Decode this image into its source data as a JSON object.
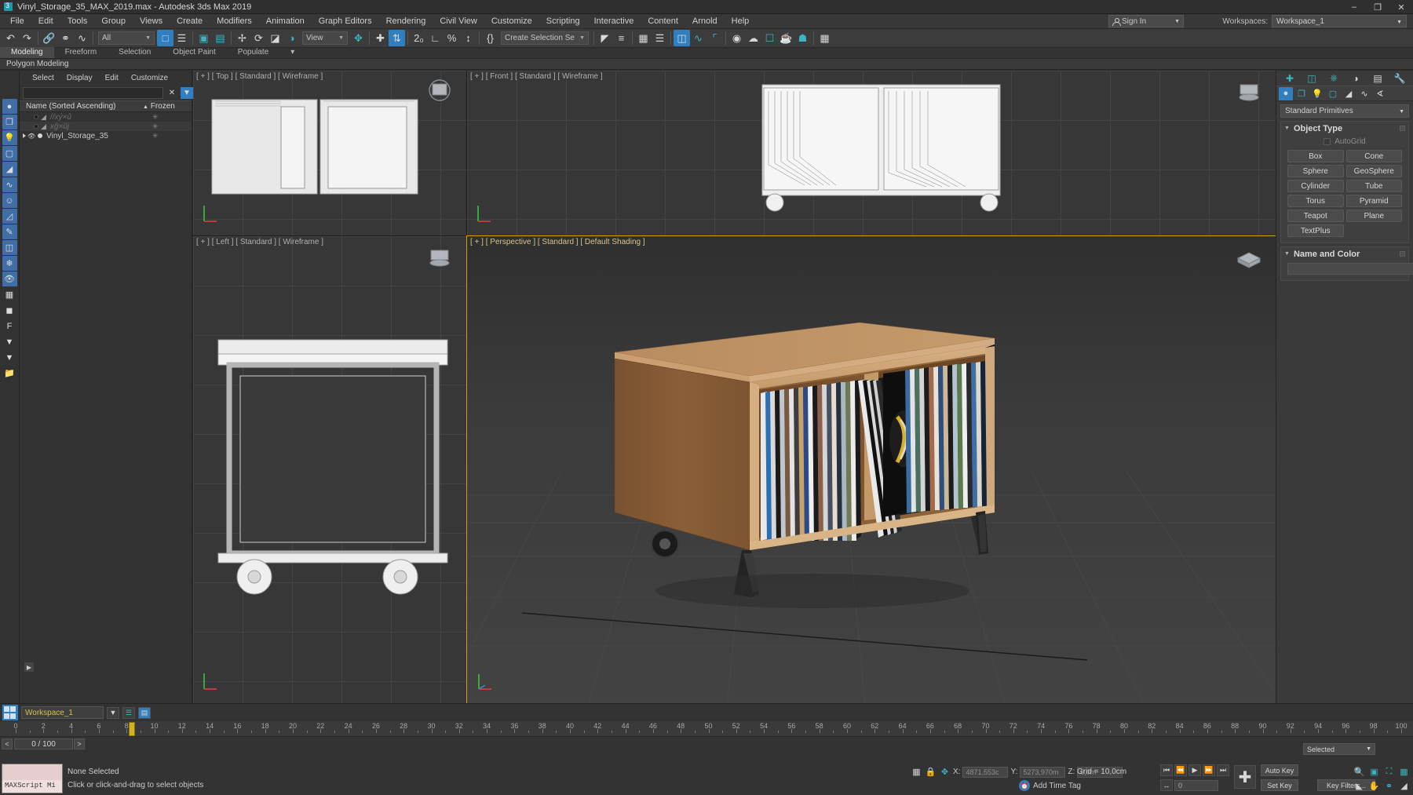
{
  "titlebar": {
    "title": "Vinyl_Storage_35_MAX_2019.max - Autodesk 3ds Max 2019",
    "minimize": "–",
    "maximize": "❐",
    "close": "✕"
  },
  "menubar": {
    "items": [
      "File",
      "Edit",
      "Tools",
      "Group",
      "Views",
      "Create",
      "Modifiers",
      "Animation",
      "Graph Editors",
      "Rendering",
      "Civil View",
      "Customize",
      "Scripting",
      "Interactive",
      "Content",
      "Arnold",
      "Help"
    ],
    "signin": "Sign In",
    "workspaces_label": "Workspaces:",
    "workspace_value": "Workspace_1"
  },
  "toolbar": {
    "selection_filter": "All",
    "selection_set": "Create Selection Se",
    "ref_coord": "View",
    "icons": [
      "undo",
      "redo",
      "select-link",
      "unlink",
      "bind-space-warp",
      "select-object",
      "select-by-name",
      "rectangular-select",
      "window-crossing",
      "select-and-move",
      "select-and-rotate",
      "select-and-scale",
      "place-tool",
      "snaps-toggle",
      "angle-snap",
      "percent-snap",
      "spinner-snap",
      "named-selection-sets",
      "mirror",
      "align",
      "layer-explorer",
      "scene-explorer",
      "ribbon-toggle",
      "curve-editor",
      "schematic-view",
      "material-editor",
      "render-setup",
      "render-frame",
      "render-production"
    ]
  },
  "ribbon": {
    "tabs": [
      "Modeling",
      "Freeform",
      "Selection",
      "Object Paint",
      "Populate"
    ],
    "active_tab": "Modeling",
    "subtitle": "Polygon Modeling"
  },
  "explorer": {
    "menu": [
      "Select",
      "Display",
      "Edit",
      "Customize"
    ],
    "search_placeholder": "",
    "col_name": "Name (Sorted Ascending)",
    "col_frozen": "Frozen",
    "rows": [
      {
        "name": "//xý×û",
        "frozen": "✳",
        "dim": true
      },
      {
        "name": "xĝ×ŭj",
        "frozen": "✳",
        "dim": true
      },
      {
        "name": "Vinyl_Storage_35",
        "frozen": "✳",
        "dim": false
      }
    ]
  },
  "viewports": [
    {
      "id": "top",
      "label": "[ + ] [ Top ] [ Standard ] [ Wireframe ]",
      "active": false
    },
    {
      "id": "front",
      "label": "[ + ] [ Front ] [ Standard ] [ Wireframe ]",
      "active": false
    },
    {
      "id": "left",
      "label": "[ + ] [ Left ] [ Standard ] [ Wireframe ]",
      "active": false
    },
    {
      "id": "perspective",
      "label": "[ + ] [ Perspective ] [ Standard ] [ Default Shading ]",
      "active": true
    }
  ],
  "command_panel": {
    "tabs": [
      "create-tab",
      "modify-tab",
      "hierarchy-tab",
      "motion-tab",
      "display-tab",
      "utilities-tab"
    ],
    "category": "Standard Primitives",
    "object_type": {
      "title": "Object Type",
      "autogrid": "AutoGrid",
      "buttons": [
        "Box",
        "Cone",
        "Sphere",
        "GeoSphere",
        "Cylinder",
        "Tube",
        "Torus",
        "Pyramid",
        "Teapot",
        "Plane",
        "TextPlus"
      ]
    },
    "name_and_color": {
      "title": "Name and Color",
      "name_value": "",
      "color": "#e0379a"
    }
  },
  "bottom": {
    "workspace_name": "Workspace_1",
    "frame_counter": "0 / 100",
    "prev_arrow": "<",
    "next_arrow": ">",
    "ruler_labels": [
      "0",
      "2",
      "4",
      "6",
      "8",
      "10",
      "12",
      "14",
      "16",
      "18",
      "20",
      "22",
      "24",
      "26",
      "28",
      "30",
      "32",
      "34",
      "36",
      "38",
      "40",
      "42",
      "44",
      "46",
      "48",
      "50",
      "52",
      "54",
      "56",
      "58",
      "60",
      "62",
      "64",
      "66",
      "68",
      "70",
      "72",
      "74",
      "76",
      "78",
      "80",
      "82",
      "84",
      "86",
      "88",
      "90",
      "92",
      "94",
      "96",
      "98",
      "100"
    ],
    "maxscript_label": "MAXScript Mi",
    "status_line1": "None Selected",
    "status_line2": "Click or click-and-drag to select objects",
    "coord_x_label": "X:",
    "coord_x_value": "4871,553c",
    "coord_y_label": "Y:",
    "coord_y_value": "5273,970m",
    "coord_z_label": "Z:",
    "coord_z_value": "0,0m",
    "grid_text": "Grid = 10,0cm",
    "add_time_tag": "Add Time Tag",
    "auto_key": "Auto Key",
    "set_key": "Set Key",
    "selection_filter": "Selected",
    "key_filters": "Key Filters...",
    "frame_field": "0"
  }
}
